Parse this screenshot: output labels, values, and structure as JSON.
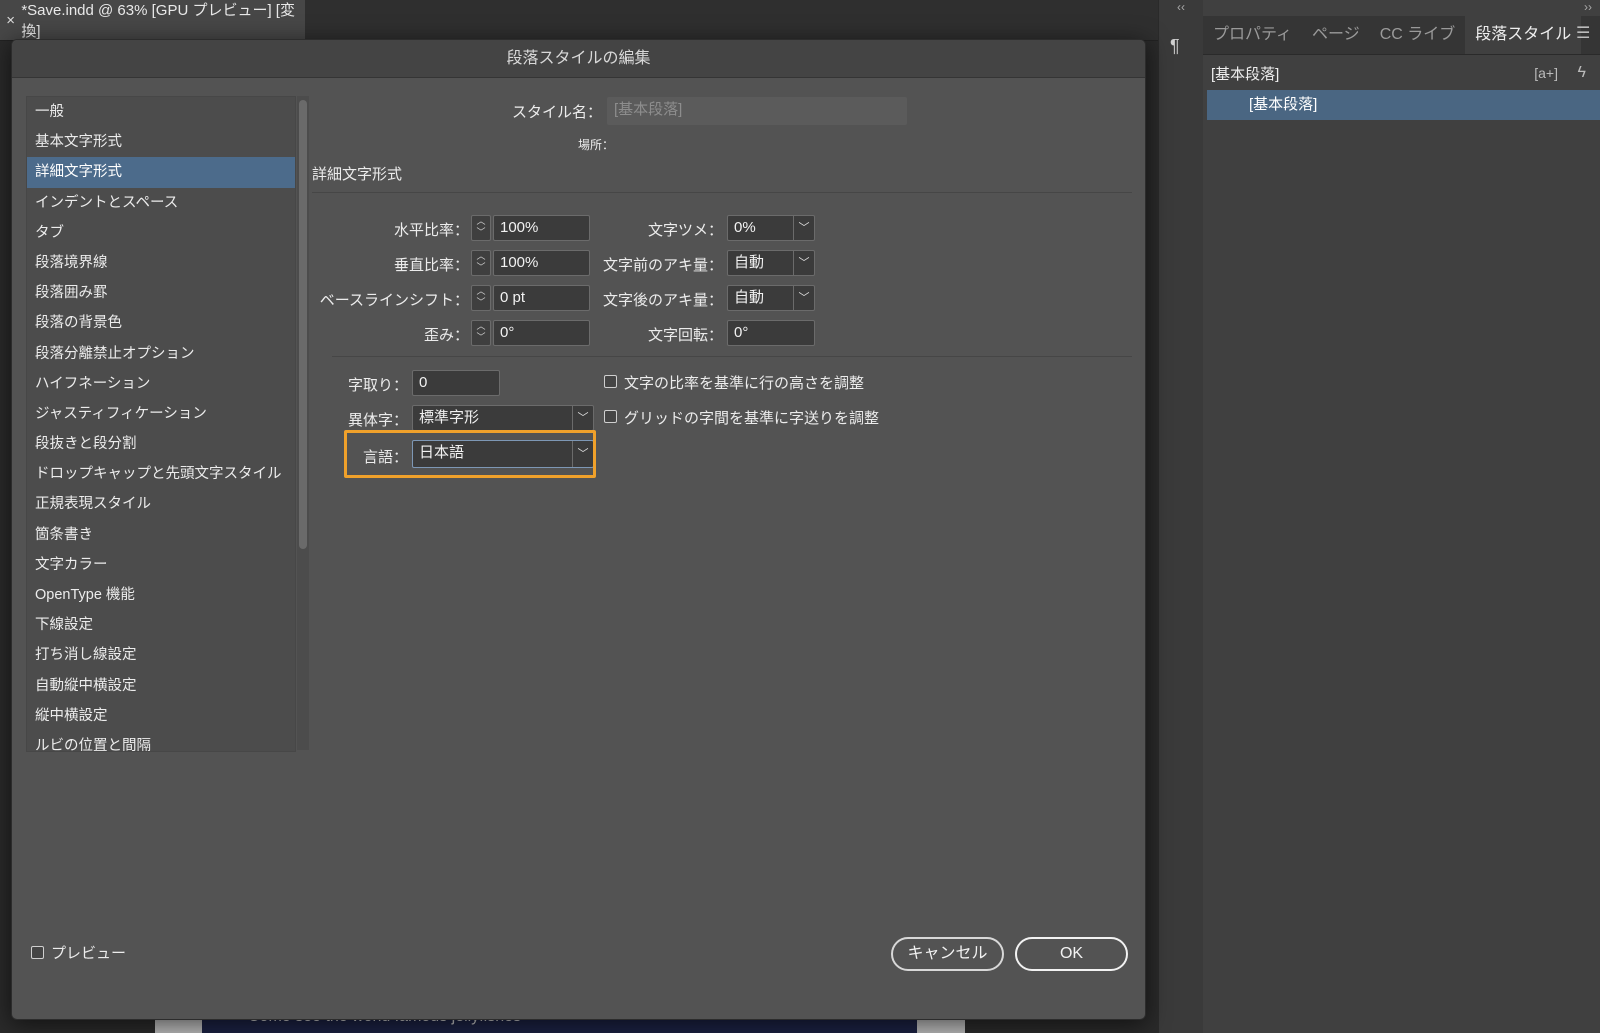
{
  "document_tab": {
    "close_glyph": "×",
    "title": "*Save.indd @ 63% [GPU プレビュー] [変換]"
  },
  "document_preview_text": "Come see the world famous jellyfishes",
  "right_panel": {
    "tabs": [
      "プロパティ",
      "ページ",
      "CC ライブ",
      "段落スタイル"
    ],
    "active_tab": "段落スタイル",
    "current_style": "[基本段落]",
    "new_style_icon": "[a+]",
    "quick_apply_icon": "lightning-icon",
    "selected_item": "[基本段落]"
  },
  "dialog": {
    "title": "段落スタイルの編集",
    "categories": [
      "一般",
      "基本文字形式",
      "詳細文字形式",
      "インデントとスペース",
      "タブ",
      "段落境界線",
      "段落囲み罫",
      "段落の背景色",
      "段落分離禁止オプション",
      "ハイフネーション",
      "ジャスティフィケーション",
      "段抜きと段分割",
      "ドロップキャップと先頭文字スタイル",
      "正規表現スタイル",
      "箇条書き",
      "文字カラー",
      "OpenType 機能",
      "下線設定",
      "打ち消し線設定",
      "自動縦中横設定",
      "縦中横設定",
      "ルビの位置と間隔"
    ],
    "selected_category_index": 2,
    "style_name_label": "スタイル名：",
    "style_name_value": "[基本段落]",
    "location_label": "場所：",
    "section_title": "詳細文字形式",
    "horizontal_scale": {
      "label": "水平比率：",
      "value": "100%"
    },
    "vertical_scale": {
      "label": "垂直比率：",
      "value": "100%"
    },
    "baseline_shift": {
      "label": "ベースラインシフト：",
      "value": "0 pt"
    },
    "skew": {
      "label": "歪み：",
      "value": "0°"
    },
    "tsume": {
      "label": "文字ツメ：",
      "value": "0%"
    },
    "aki_before": {
      "label": "文字前のアキ量：",
      "value": "自動"
    },
    "aki_after": {
      "label": "文字後のアキ量：",
      "value": "自動"
    },
    "char_rotation": {
      "label": "文字回転：",
      "value": "0°"
    },
    "mojidori": {
      "label": "字取り：",
      "value": "0"
    },
    "variant": {
      "label": "異体字：",
      "value": "標準字形"
    },
    "language": {
      "label": "言語：",
      "value": "日本語"
    },
    "check_scale_line_height": "文字の比率を基準に行の高さを調整",
    "check_grid_spacing": "グリッドの字間を基準に字送りを調整",
    "preview_label": "プレビュー",
    "cancel_label": "キャンセル",
    "ok_label": "OK",
    "highlight_color": "#f0a12b"
  }
}
